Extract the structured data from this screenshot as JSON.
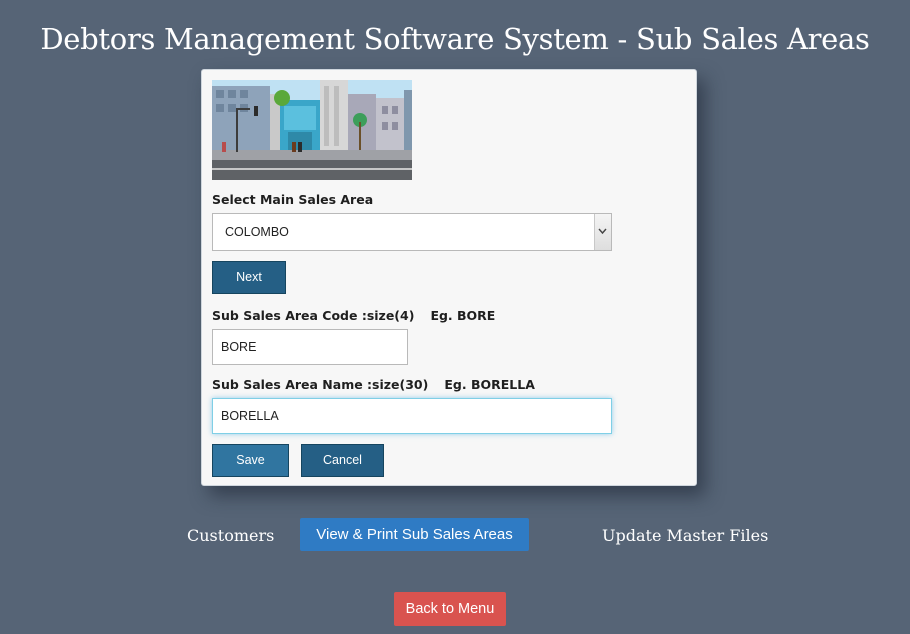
{
  "page": {
    "title": "Debtors Management Software System - Sub Sales Areas"
  },
  "form": {
    "main_area_label": "Select Main Sales Area",
    "main_area_selected": "COLOMBO",
    "next_label": "Next",
    "code_label": "Sub Sales Area Code :size(4)",
    "code_example": "Eg. BORE",
    "code_value": "BORE",
    "name_label": "Sub Sales Area Name :size(30)",
    "name_example": "Eg. BORELLA",
    "name_value": "BORELLA",
    "save_label": "Save",
    "cancel_label": "Cancel"
  },
  "nav": {
    "customers": "Customers",
    "view_print": "View & Print Sub Sales Areas",
    "update_master": "Update Master Files",
    "back_menu": "Back to Menu"
  },
  "colors": {
    "background": "#566476",
    "primary_button": "#255f85",
    "nav_button": "#2f7bc4",
    "danger_button": "#d9534f"
  }
}
